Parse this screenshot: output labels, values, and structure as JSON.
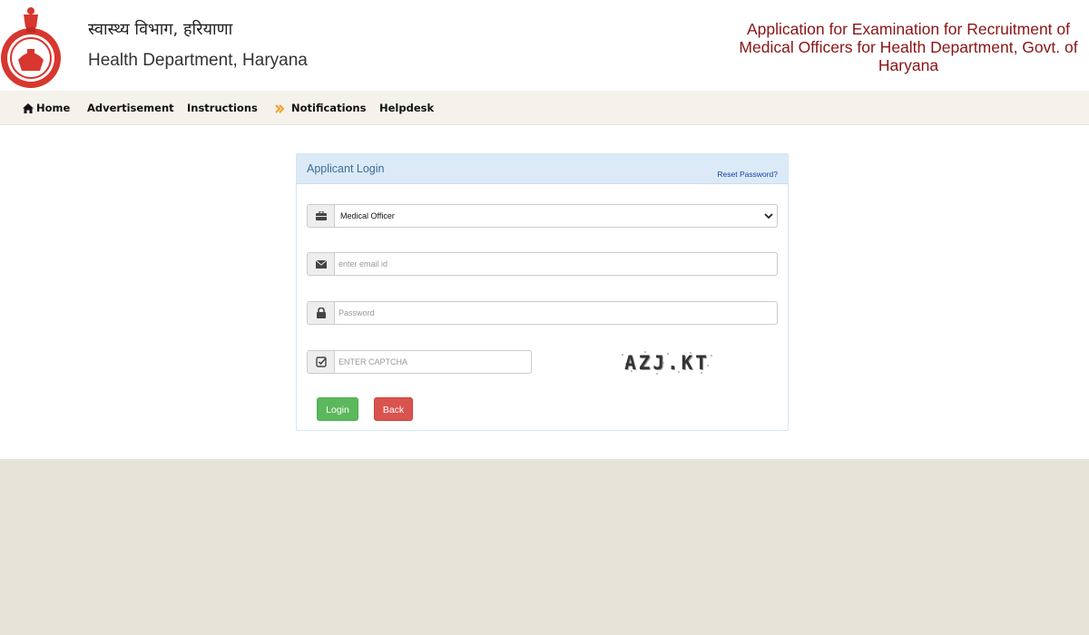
{
  "header": {
    "hindi_title": "स्वास्थ्य विभाग, हरियाणा",
    "english_title": "Health Department, Haryana",
    "app_title": "Application for Examination for Recruitment of Medical Officers for Health Department, Govt. of Haryana",
    "emblem_icon": "haryana-government-emblem",
    "title_color": "#8b1414"
  },
  "nav": {
    "items": [
      {
        "label": "Home",
        "icon": "home-icon"
      },
      {
        "label": "Advertisement"
      },
      {
        "label": "Instructions"
      },
      {
        "label": "Notifications",
        "icon": "double-chevron-right-icon"
      },
      {
        "label": "Helpdesk"
      }
    ]
  },
  "login": {
    "title": "Applicant Login",
    "reset_link": "Reset Password?",
    "post_select": {
      "value": "Medical Officer",
      "icon": "briefcase-icon"
    },
    "email": {
      "value": "",
      "placeholder": "enter email id",
      "icon": "envelope-icon"
    },
    "password": {
      "value": "",
      "placeholder": "Password",
      "icon": "lock-icon"
    },
    "captcha": {
      "value": "",
      "placeholder": "ENTER CAPTCHA",
      "icon": "check-square-icon",
      "image_text": "AZJ.KT"
    },
    "login_button": "Login",
    "back_button": "Back",
    "colors": {
      "login": "#5cb85c",
      "back": "#d9534f",
      "heading_bg": "#dbeaf6"
    }
  }
}
